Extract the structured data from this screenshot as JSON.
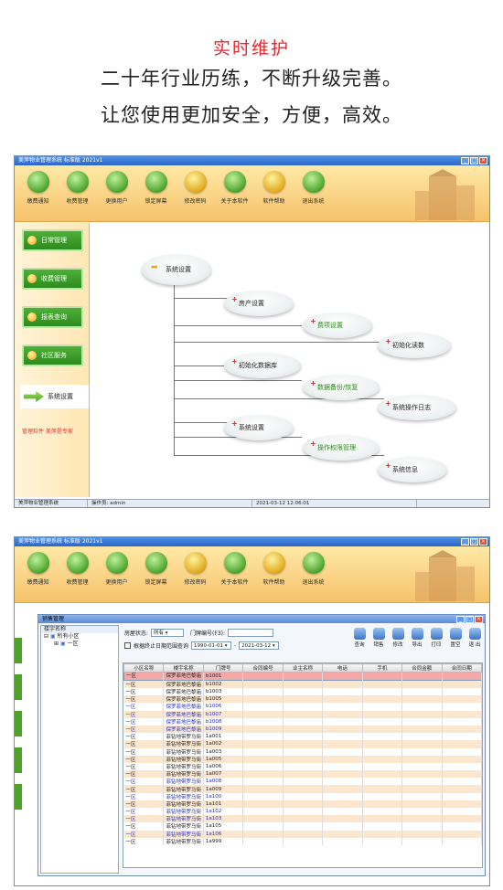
{
  "hero": {
    "title": "实时维护",
    "line1": "二十年行业历练，不断升级完善。",
    "line2": "让您使用更加安全，方便，高效。"
  },
  "window1": {
    "title": "美萍物业管理系统 标准版 2021v1",
    "toolbar": [
      "缴费通知",
      "收费管理",
      "更换用户",
      "锁定屏幕",
      "修改密码",
      "关于本软件",
      "软件帮助",
      "退出系统"
    ],
    "sidebar": [
      "日常管理",
      "收费管理",
      "报表查询",
      "社区服务"
    ],
    "sidebar_selected": "系统设置",
    "sidebar_note": "管理软件 美萍是专家",
    "nodes": {
      "root": "系统设置",
      "n1": "房产设置",
      "n2": "费项设置",
      "n3": "初始化读数",
      "n4": "初始化数据库",
      "n5": "数据备份/恢复",
      "n6": "系统操作日志",
      "n7": "系统设置",
      "n8": "操作权限管理",
      "n9": "系统信息"
    },
    "status": {
      "app": "美萍物业管理系统",
      "user": "操作员: admin",
      "time": "2021-03-12 12:06:01"
    }
  },
  "window2": {
    "title": "美萍物业管理系统 标准版 2021v1",
    "toolbar": [
      "缴费通知",
      "收费管理",
      "更换用户",
      "锁定屏幕",
      "修改密码",
      "关于本软件",
      "软件帮助",
      "退出系统"
    ],
    "sub_title": "销售管理",
    "tree": {
      "header": "楼宇名称",
      "root": "所有小区",
      "child": "一区"
    },
    "filters": {
      "status_label": "房屋状态:",
      "status_value": "所有",
      "door_label": "门牌编号(F3):",
      "date_check": "根据终止日期范围查询",
      "date_from": "1990-01-01",
      "date_to": "2021-03-12"
    },
    "actions": [
      "查询",
      "销售",
      "修改",
      "导出",
      "打印",
      "置空",
      "退 出"
    ],
    "columns": [
      "小区名称",
      "楼宇名称",
      "门牌号",
      "合同编号",
      "业主名称",
      "电话",
      "手机",
      "合同金额",
      "合同日期"
    ],
    "rows": [
      [
        "一区",
        "保罗菲地巴黎庙",
        "b1001"
      ],
      [
        "一区",
        "保罗菲地巴黎庙",
        "b1002"
      ],
      [
        "一区",
        "保罗菲地巴黎庙",
        "b1003"
      ],
      [
        "一区",
        "保罗菲地巴黎庙",
        "b1005"
      ],
      [
        "一区",
        "保罗菲地巴黎庙",
        "b1006"
      ],
      [
        "一区",
        "保罗菲地巴黎庙",
        "b1007"
      ],
      [
        "一区",
        "保罗菲地巴黎庙",
        "b1008"
      ],
      [
        "一区",
        "保罗菲地巴黎庙",
        "b1009"
      ],
      [
        "一区",
        "菲钻地带罗马街",
        "1a001"
      ],
      [
        "一区",
        "菲钻地带罗马街",
        "1a002"
      ],
      [
        "一区",
        "菲钻地带罗马街",
        "1a003"
      ],
      [
        "一区",
        "菲钻地带罗马街",
        "1a005"
      ],
      [
        "一区",
        "菲钻地带罗马街",
        "1a006"
      ],
      [
        "一区",
        "菲钻地带罗马街",
        "1a007"
      ],
      [
        "一区",
        "菲钻地带罗马街",
        "1a008"
      ],
      [
        "一区",
        "菲钻地带罗马街",
        "1a009"
      ],
      [
        "一区",
        "菲钻地带罗马街",
        "1a100"
      ],
      [
        "一区",
        "菲钻地带罗马街",
        "1a101"
      ],
      [
        "一区",
        "菲钻地带罗马街",
        "1a102"
      ],
      [
        "一区",
        "菲钻地带罗马街",
        "1a103"
      ],
      [
        "一区",
        "菲钻地带罗马街",
        "1a105"
      ],
      [
        "一区",
        "菲钻地带罗马街",
        "1a106"
      ],
      [
        "一区",
        "菲钻地带罗马街",
        "1a999"
      ]
    ]
  }
}
